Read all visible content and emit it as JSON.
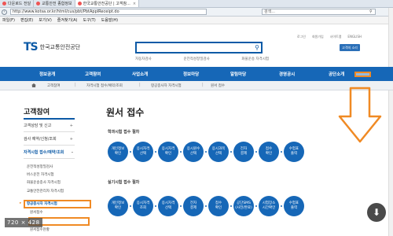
{
  "browser": {
    "tabs": [
      {
        "label": "다운로드 전달",
        "active": false
      },
      {
        "label": "교통안전 종합정보",
        "active": false
      },
      {
        "label": "한국교통안전공단 | 고객참...",
        "active": true
      }
    ],
    "url": "http://www.kotsa.or.kr/html/cus/pbt/PbtApplReceipt.do",
    "search_placeholder": "검색...",
    "menu": [
      "파일(F)",
      "편집(E)",
      "보기(V)",
      "즐겨찾기(A)",
      "도구(T)",
      "도움말(H)"
    ]
  },
  "header": {
    "util_links": [
      "로그인",
      "회원가입",
      "사이트맵",
      "ENGLISH"
    ],
    "logo_mark": "TS",
    "logo_text": "한국교통안전공단",
    "keywords": [
      "자동차검사",
      "운전적성정밀검사",
      "화물운송 자격시험"
    ],
    "right_button": "고객의 소리"
  },
  "nav": {
    "items": [
      "정보공개",
      "고객참여",
      "사업소개",
      "정보마당",
      "알림마당",
      "경영공시",
      "공단소개"
    ]
  },
  "breadcrumb": [
    "고객참여",
    "자격시험 접수/예약/조회",
    "항공종사자 자격시험",
    "원서 접수"
  ],
  "sidebar": {
    "title": "고객참여",
    "items": [
      {
        "label": "고객상담 및 신고",
        "plus": "+"
      },
      {
        "label": "검사 예약/신청/조회",
        "plus": "+"
      },
      {
        "label": "자격시험 접수/예약/조회",
        "plus": "-"
      }
    ],
    "subitems": [
      "운전적성정밀검사",
      "버스운전 자격시험",
      "화물운송종사 자격시험",
      "교통안전관리자 자격시험",
      "항공종사자 자격시험",
      "원서접수",
      "원서접수현황"
    ],
    "arrow": "▸"
  },
  "main": {
    "title": "원서 접수",
    "section1": "학과시험 접수 절차",
    "section2": "실기시험 접수 절차",
    "steps1": [
      "개인정보\n확인",
      "응시자격\n선택",
      "응시자격\n확인",
      "응시원수\n선택",
      "응시과목\n선택",
      "전자\n결제",
      "접수\n확인",
      "수험표\n출력"
    ],
    "steps2": [
      "개인정보\n확인",
      "응시자격\n조회",
      "응시자격\n선택",
      "전자\n결제",
      "접수\n확인",
      "공단SMS\n(사전/완료)",
      "시험장소\n시간확인",
      "수험표\n출력"
    ]
  },
  "overlay": {
    "zoom": "720 × 428",
    "download_icon": "⬇",
    "highlight_color": "#f08a24"
  }
}
